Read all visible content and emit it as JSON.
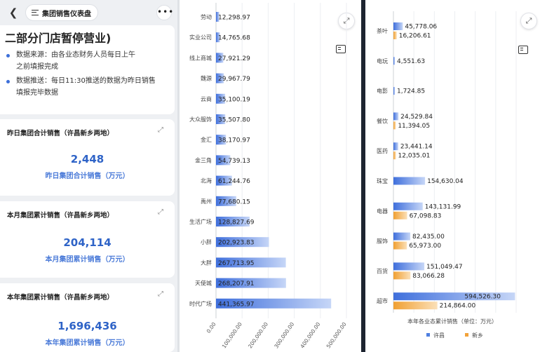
{
  "header": {
    "back_icon": "back-arrow-icon",
    "title": "集团销售仪表盘",
    "more_icon": "more-dots-icon"
  },
  "notice": {
    "title": "二部分门店暂停营业)",
    "items": [
      "数据来源：由各业态财务人员每日上午\n之前填报完成",
      "数据推送：每日11:30推送的数据为昨日销售\n填报完毕数据"
    ]
  },
  "kpis": [
    {
      "title": "昨日集团合计销售（许昌新乡两地）",
      "value": "2,448",
      "label": "昨日集团合计销售（万元）"
    },
    {
      "title": "本月集团累计销售（许昌新乡两地）",
      "value": "204,114",
      "label": "本月集团累计销售（万元）"
    },
    {
      "title": "本年集团累计销售（许昌新乡两地）",
      "value": "1,696,436",
      "label": "本年集团累计销售（万元）"
    }
  ],
  "colors": {
    "accent": "#2e63c7",
    "bar_blue": "#4f7fe0",
    "bar_orange": "#f2a23a",
    "divider": "#1d2430"
  },
  "chart_data": [
    {
      "type": "bar",
      "orientation": "horizontal",
      "categories": [
        "劳动",
        "实业公司",
        "线上商城",
        "魏源",
        "云商",
        "大众服饰",
        "金汇",
        "金三角",
        "北海",
        "禹州",
        "生活广场",
        "小胖",
        "大胖",
        "天使城",
        "时代广场"
      ],
      "values": [
        12298.97,
        14765.68,
        27921.29,
        29967.79,
        35100.19,
        35507.8,
        38170.97,
        54739.13,
        61244.76,
        77680.15,
        128827.69,
        202923.83,
        267713.95,
        268207.91,
        441365.97
      ],
      "value_labels": [
        "12,298.97",
        "14,765.68",
        "27,921.29",
        "29,967.79",
        "35,100.19",
        "35,507.80",
        "38,170.97",
        "54,739.13",
        "61,244.76",
        "77,680.15",
        "128,827.69",
        "202,923.83",
        "267,713.95",
        "268,207.91",
        "441,365.97"
      ],
      "xlim": [
        0,
        500000
      ],
      "xticks": [
        "0.00",
        "100,000.00",
        "200,000.00",
        "300,000.00",
        "400,000.00",
        "500,000.00"
      ],
      "grid": true
    },
    {
      "type": "bar",
      "orientation": "horizontal",
      "categories": [
        "茶叶",
        "电玩",
        "电影",
        "餐饮",
        "医药",
        "珠宝",
        "电器",
        "服饰",
        "百货",
        "超市"
      ],
      "series": [
        {
          "name": "许昌",
          "values": [
            45778.06,
            4551.63,
            1724.85,
            24529.84,
            23441.14,
            154630.04,
            143131.99,
            82435.0,
            151049.47,
            594526.3
          ],
          "labels": [
            "45,778.06",
            "4,551.63",
            "1,724.85",
            "24,529.84",
            "23,441.14",
            "154,630.04",
            "143,131.99",
            "82,435.00",
            "151,049.47",
            "594,526.30"
          ]
        },
        {
          "name": "新乡",
          "values": [
            16206.61,
            null,
            null,
            11394.05,
            12035.01,
            null,
            67098.83,
            65973.0,
            83066.28,
            214864.0
          ],
          "labels": [
            "16,206.61",
            "",
            "",
            "11,394.05",
            "12,035.01",
            "",
            "67,098.83",
            "65,973.00",
            "83,066.28",
            "214,864.00"
          ]
        }
      ],
      "xlim": [
        0,
        600000
      ],
      "xlabel": "本年各业态累计销售（单位：万元）",
      "legend": "bottom",
      "grid": true
    }
  ]
}
